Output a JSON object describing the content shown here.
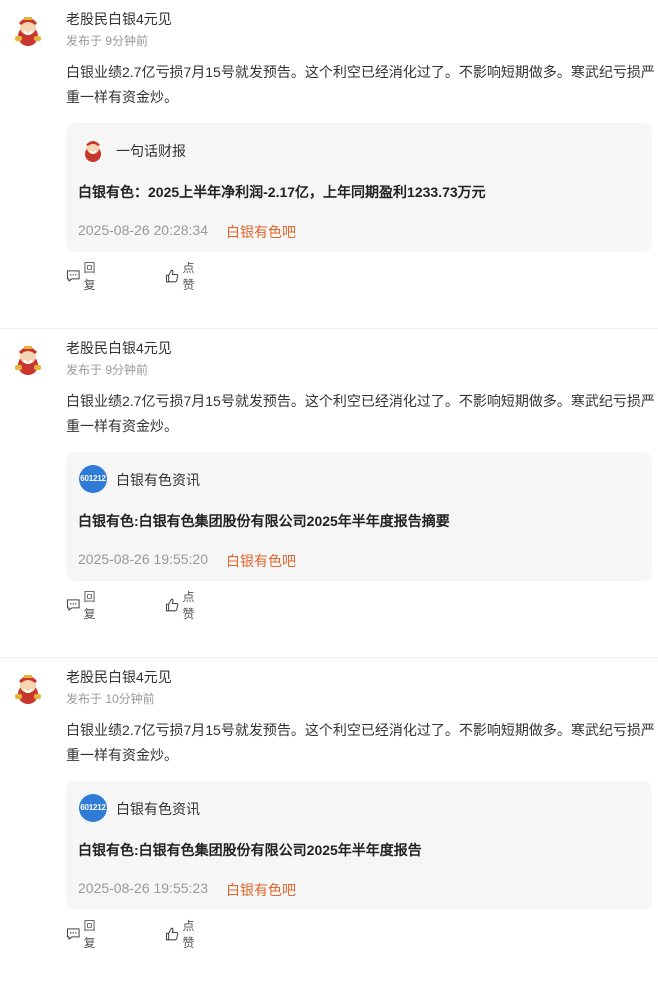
{
  "posts": [
    {
      "username": "老股民白银4元见",
      "time": "发布于 9分钟前",
      "content": "白银业绩2.7亿亏损7月15号就发预告。这个利空已经消化过了。不影响短期做多。寒武纪亏损严重一样有资金炒。",
      "quote": {
        "source_icon": "caishen-icon",
        "source": "一句话财报",
        "title": "白银有色：2025上半年净利润-2.17亿，上年同期盈利1233.73万元",
        "datetime": "2025-08-26 20:28:34",
        "bar": "白银有色吧"
      },
      "reply_label": "回复",
      "like_label": "点赞"
    },
    {
      "username": "老股民白银4元见",
      "time": "发布于 9分钟前",
      "content": "白银业绩2.7亿亏损7月15号就发预告。这个利空已经消化过了。不影响短期做多。寒武纪亏损严重一样有资金炒。",
      "quote": {
        "source_icon": "stock-code-badge",
        "badge_text": "601212",
        "source": "白银有色资讯",
        "title": "白银有色:白银有色集团股份有限公司2025年半年度报告摘要",
        "datetime": "2025-08-26 19:55:20",
        "bar": "白银有色吧"
      },
      "reply_label": "回复",
      "like_label": "点赞"
    },
    {
      "username": "老股民白银4元见",
      "time": "发布于 10分钟前",
      "content": "白银业绩2.7亿亏损7月15号就发预告。这个利空已经消化过了。不影响短期做多。寒武纪亏损严重一样有资金炒。",
      "quote": {
        "source_icon": "stock-code-badge",
        "badge_text": "601212",
        "source": "白银有色资讯",
        "title": "白银有色:白银有色集团股份有限公司2025年半年度报告",
        "datetime": "2025-08-26 19:55:23",
        "bar": "白银有色吧"
      },
      "reply_label": "回复",
      "like_label": "点赞"
    }
  ],
  "colors": {
    "link": "#e0662d",
    "badge": "#2f7bd8",
    "quote_bg": "#f6f6f7"
  }
}
